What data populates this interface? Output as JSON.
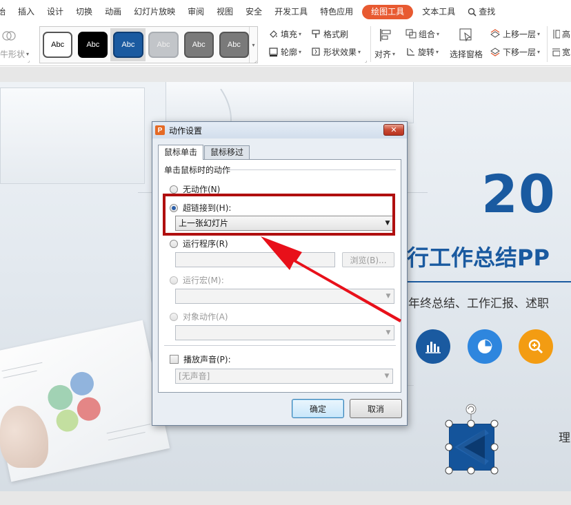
{
  "menu": {
    "items": [
      "始",
      "插入",
      "设计",
      "切换",
      "动画",
      "幻灯片放映",
      "审阅",
      "视图",
      "安全",
      "开发工具",
      "特色应用",
      "绘图工具",
      "文本工具"
    ],
    "active_index": 11,
    "search_label": "查找",
    "active_color": "#e85a31"
  },
  "ribbon": {
    "shape_label": "牛形状",
    "style_presets": [
      {
        "label": "Abc",
        "fill": "#ffffff",
        "text": "#000000",
        "border": "#555555"
      },
      {
        "label": "Abc",
        "fill": "#000000",
        "text": "#ffffff",
        "border": "#000000"
      },
      {
        "label": "Abc",
        "fill": "#1a5aa0",
        "text": "#ffffff",
        "border": "#0e3d73"
      },
      {
        "label": "Abc",
        "fill": "#c2c5c9",
        "text": "#eeeeee",
        "border": "#a9adb2"
      },
      {
        "label": "Abc",
        "fill": "#7a7a7a",
        "text": "#ffffff",
        "border": "#555555"
      },
      {
        "label": "Abc",
        "fill": "#7a7a7a",
        "text": "#ffffff",
        "border": "#555555"
      }
    ],
    "selected_preset": 2,
    "fill_label": "填充",
    "format_painter_label": "格式刷",
    "outline_label": "轮廓",
    "shape_effects_label": "形状效果",
    "align_label": "对齐",
    "group_label": "组合",
    "rotate_label": "旋转",
    "selection_pane_label": "选择窗格",
    "bring_forward_label": "上移一层",
    "send_backward_label": "下移一层",
    "cut_char_top": "高",
    "cut_char_bottom": "宽"
  },
  "slide": {
    "big_number": "20",
    "title": "行工作总结PP",
    "subtitle": "年终总结、工作汇报、述职",
    "side_text": "理",
    "accent_color": "#1a5aa0",
    "icons": [
      {
        "name": "bar-chart-icon",
        "color": "#1a5aa0"
      },
      {
        "name": "pie-chart-icon",
        "color": "#2e86de"
      },
      {
        "name": "magnifier-plus-icon",
        "color": "#f39c12"
      }
    ]
  },
  "dialog": {
    "title": "动作设置",
    "tabs": [
      "鼠标单击",
      "鼠标移过"
    ],
    "active_tab": 0,
    "group_title": "单击鼠标时的动作",
    "options": {
      "none": "无动作(N)",
      "hyperlink": "超链接到(H):",
      "run_program": "运行程序(R)",
      "run_macro": "运行宏(M):",
      "object_action": "对象动作(A)"
    },
    "selected_option": "hyperlink",
    "hyperlink_value": "上一张幻灯片",
    "program_value": "",
    "browse_label": "浏览(B)...",
    "macro_value": "",
    "object_value": "",
    "play_sound_label": "播放声音(P):",
    "play_sound_checked": false,
    "sound_value": "[无声音]",
    "ok_label": "确定",
    "cancel_label": "取消"
  },
  "annotation": {
    "highlight_color": "#b00f0f",
    "arrow_color": "#e8101a"
  }
}
